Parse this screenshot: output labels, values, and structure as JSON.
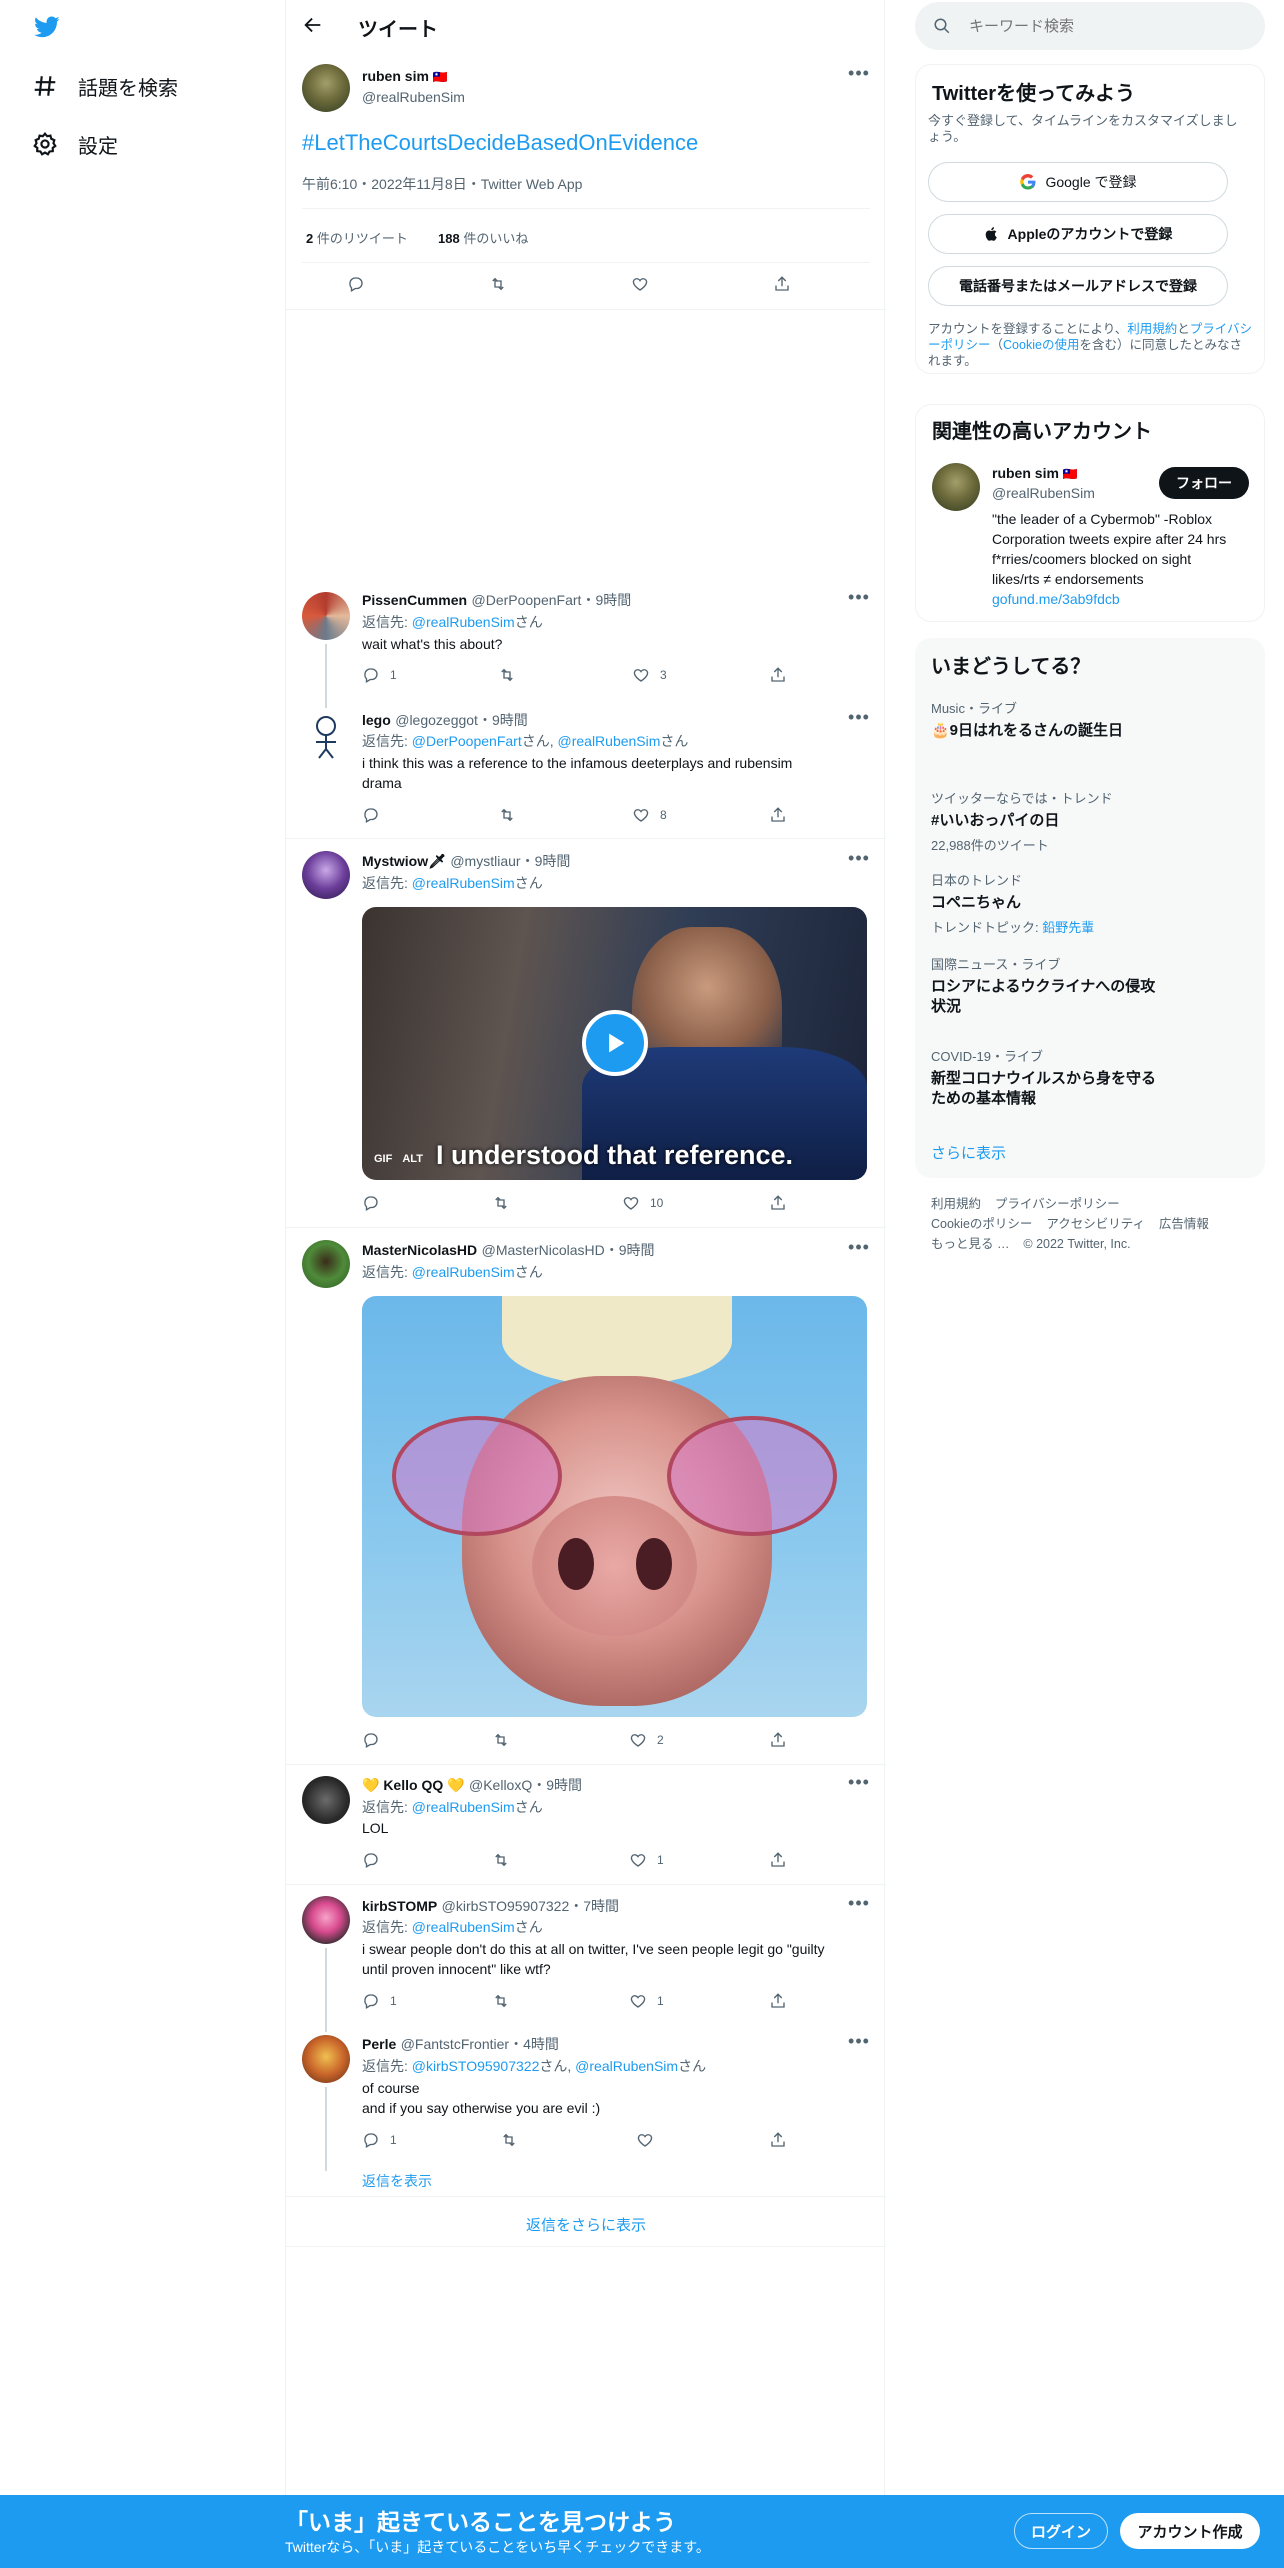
{
  "nav": {
    "items": [
      {
        "label": "話題を検索",
        "icon": "hashtag-icon"
      },
      {
        "label": "設定",
        "icon": "gear-icon"
      }
    ]
  },
  "header": {
    "title": "ツイート"
  },
  "main_tweet": {
    "name": "ruben sim",
    "flag": "🇹🇼",
    "handle": "@realRubenSim",
    "text": "#LetTheCourtsDecideBasedOnEvidence",
    "meta": "午前6:10・2022年11月8日・Twitter Web App",
    "retweets_count": "2",
    "retweets_label": "件のリツイート",
    "likes_count": "188",
    "likes_label": "件のいいね"
  },
  "replies": [
    {
      "name": "PissenCummen",
      "handle": "@DerPoopenFart",
      "time": "9時間",
      "reply_to_prefix": "返信先: ",
      "reply_to": [
        {
          "user": "@realRubenSim",
          "suffix": "さん"
        }
      ],
      "text": [
        "wait what's this about?"
      ],
      "reply_count": "1",
      "retweet_count": "",
      "like_count": "3"
    },
    {
      "name": "lego",
      "handle": "@legozeggot",
      "time": "9時間",
      "reply_to_prefix": "返信先: ",
      "reply_to": [
        {
          "user": "@DerPoopenFart",
          "suffix": "さん, "
        },
        {
          "user": "@realRubenSim",
          "suffix": "さん"
        }
      ],
      "text": [
        "i think this was a reference to the infamous deeterplays and rubensim",
        "drama"
      ],
      "reply_count": "",
      "retweet_count": "",
      "like_count": "8"
    },
    {
      "name": "Mystwiow🗡",
      "handle": "@mystliaur",
      "time": "9時間",
      "reply_to_prefix": "返信先: ",
      "reply_to": [
        {
          "user": "@realRubenSim",
          "suffix": "さん"
        }
      ],
      "media": {
        "type": "gif",
        "caption": "I understood that reference.",
        "badge_gif": "GIF",
        "badge_alt": "ALT"
      },
      "reply_count": "",
      "retweet_count": "",
      "like_count": "10"
    },
    {
      "name": "MasterNicolasHD",
      "handle": "@MasterNicolasHD",
      "time": "9時間",
      "reply_to_prefix": "返信先: ",
      "reply_to": [
        {
          "user": "@realRubenSim",
          "suffix": "さん"
        }
      ],
      "reply_count": "",
      "retweet_count": "",
      "like_count": "2"
    },
    {
      "name": "💛 Kello QQ 💛",
      "handle": "@KelloxQ",
      "time": "9時間",
      "reply_to_prefix": "返信先: ",
      "reply_to": [
        {
          "user": "@realRubenSim",
          "suffix": "さん"
        }
      ],
      "text": [
        "LOL"
      ],
      "reply_count": "",
      "retweet_count": "",
      "like_count": "1"
    },
    {
      "name": "kirbSTOMP",
      "handle": "@kirbSTO95907322",
      "time": "7時間",
      "reply_to_prefix": "返信先: ",
      "reply_to": [
        {
          "user": "@realRubenSim",
          "suffix": "さん"
        }
      ],
      "text": [
        "i swear people don't do this at all on twitter, I've seen people legit go \"guilty",
        "until proven innocent\" like wtf?"
      ],
      "reply_count": "1",
      "retweet_count": "",
      "like_count": "1"
    },
    {
      "name": "Perle",
      "handle": "@FantstcFrontier",
      "time": "4時間",
      "reply_to_prefix": "返信先: ",
      "reply_to": [
        {
          "user": "@kirbSTO95907322",
          "suffix": "さん, "
        },
        {
          "user": "@realRubenSim",
          "suffix": "さん"
        }
      ],
      "text": [
        "of course",
        "and if you say otherwise you are evil :)"
      ],
      "reply_count": "1",
      "retweet_count": "",
      "like_count": ""
    }
  ],
  "show_replies": "返信を表示",
  "show_more_replies": "返信をさらに表示",
  "search": {
    "placeholder": "キーワード検索"
  },
  "signup": {
    "title": "Twitterを使ってみよう",
    "subtitle": "今すぐ登録して、タイムラインをカスタマイズしましょう。",
    "google_btn": "Google で登録",
    "apple_btn": "Appleのアカウントで登録",
    "phone_btn": "電話番号またはメールアドレスで登録",
    "legal_pre": "アカウントを登録することにより、",
    "legal_terms": "利用規約",
    "legal_and": "と",
    "legal_privacy": "プライバシーポリシー",
    "legal_mid": "（",
    "legal_cookie": "Cookieの使用",
    "legal_post": "を含む）に同意したとみなされます。"
  },
  "relevant": {
    "title": "関連性の高いアカウント",
    "name": "ruben sim",
    "flag": "🇹🇼",
    "handle": "@realRubenSim",
    "follow_btn": "フォロー",
    "bio": [
      "\"the leader of a Cybermob\" -Roblox",
      "Corporation tweets expire after 24 hrs",
      "f*rries/coomers blocked on sight",
      "likes/rts ≠ endorsements"
    ],
    "link": "gofund.me/3ab9fdcb"
  },
  "trends": {
    "title": "いまどうしてる？",
    "items": [
      {
        "category": "Music・ライブ",
        "title": "🎂9日はれをるさんの誕生日",
        "sub": ""
      },
      {
        "category": "ツイッターならでは・トレンド",
        "title": "#いいおっパイの日",
        "sub": "22,988件のツイート"
      },
      {
        "category": "日本のトレンド",
        "title": "コペニちゃん",
        "sub_pre": "トレンドトピック: ",
        "sub_link": "鉛野先輩"
      },
      {
        "category": "国際ニュース・ライブ",
        "title": "ロシアによるウクライナへの侵攻",
        "title2": "状況"
      },
      {
        "category": "COVID-19・ライブ",
        "title": "新型コロナウイルスから身を守る",
        "title2": "ための基本情報"
      }
    ],
    "show_more": "さらに表示"
  },
  "footer": {
    "links": [
      "利用規約",
      "プライバシーポリシー",
      "Cookieのポリシー",
      "アクセシビリティ",
      "広告情報",
      "もっと見る …"
    ],
    "copyright": "© 2022 Twitter, Inc."
  },
  "banner": {
    "title": "「いま」起きていることを見つけよう",
    "subtitle": "Twitterなら、「いま」起きていることをいち早くチェックできます。",
    "login": "ログイン",
    "signup": "アカウント作成"
  },
  "colors": {
    "accent": "#1d9bf0",
    "text": "#0f1419",
    "muted": "#536471"
  }
}
